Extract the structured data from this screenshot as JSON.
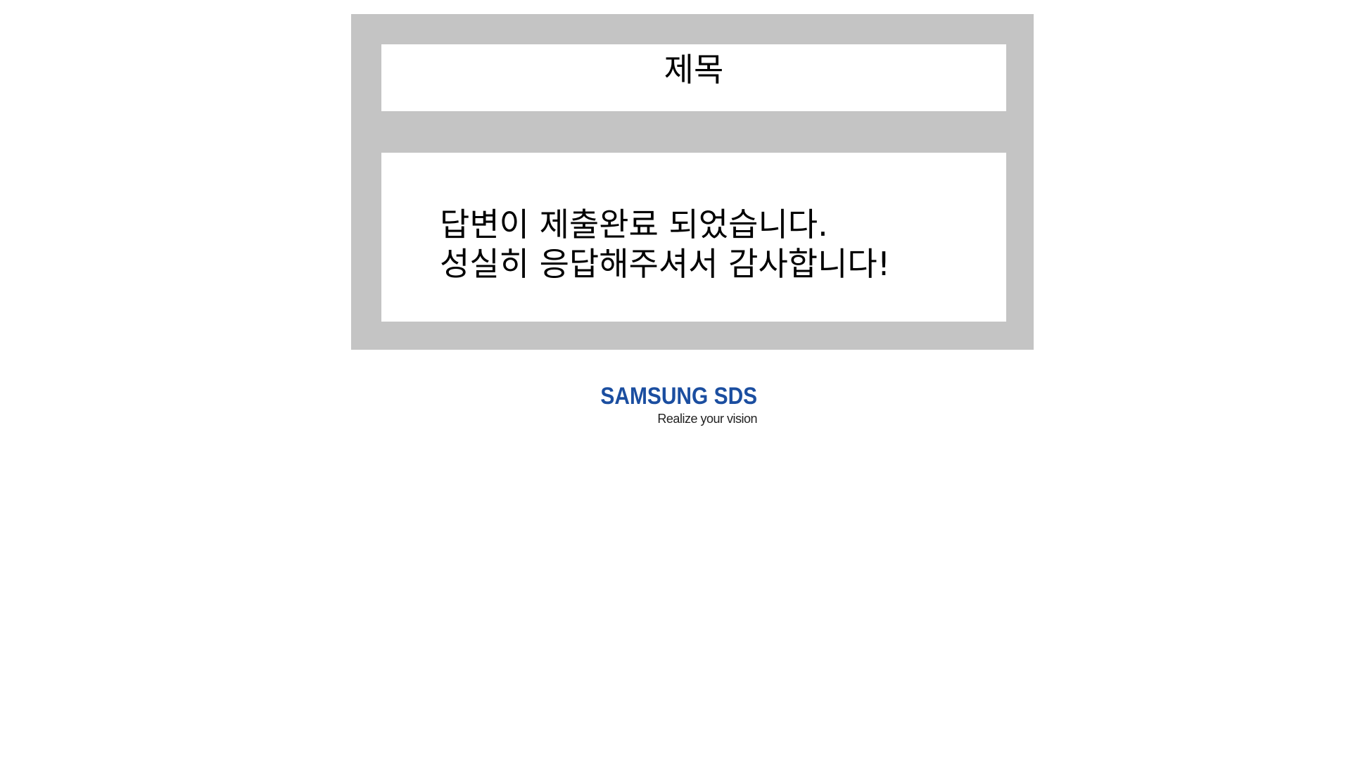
{
  "title": {
    "text": "제목"
  },
  "message": {
    "line1": "답변이 제출완료 되었습니다.",
    "line2": "성실히 응답해주셔서 감사합니다!"
  },
  "logo": {
    "brand": "SAMSUNG SDS",
    "tagline": "Realize your vision"
  },
  "colors": {
    "frame": "#c4c4c4",
    "brand_blue": "#1b4ea0",
    "text": "#000000",
    "background": "#ffffff"
  }
}
